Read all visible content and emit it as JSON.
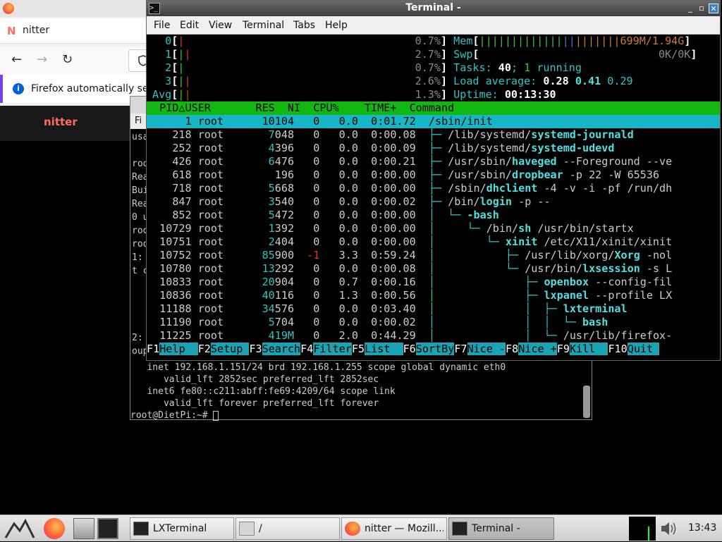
{
  "firefox": {
    "tab_title": "nitter",
    "notice": "Firefox automatically sen",
    "brand": "nitter",
    "tab_icon": "N"
  },
  "lxterminal_bg": {
    "left_column": [
      "usa",
      "",
      "roo",
      "Rea",
      "Bui",
      "Rea",
      "0 u",
      "roo",
      "roo",
      "1:",
      "t c",
      "",
      "",
      "",
      "",
      "2:",
      "oup"
    ],
    "bottom_lines": [
      "   inet 192.168.1.151/24 brd 192.168.1.255 scope global dynamic eth0",
      "      valid_lft 2852sec preferred_lft 2852sec",
      "   inet6 fe80::c211:abff:fe69:4209/64 scope link",
      "      valid_lft forever preferred_lft forever",
      "root@DietPi:~# "
    ]
  },
  "terminal": {
    "title": "Terminal -",
    "menu": [
      "File",
      "Edit",
      "View",
      "Terminal",
      "Tabs",
      "Help"
    ]
  },
  "htop": {
    "cpus": [
      {
        "label": "0",
        "pct": "0.7%"
      },
      {
        "label": "1",
        "pct": "2.7%"
      },
      {
        "label": "2",
        "pct": "0.7%"
      },
      {
        "label": "3",
        "pct": "2.6%"
      },
      {
        "label": "Avg",
        "pct": "1.3%"
      }
    ],
    "mem": {
      "label": "Mem",
      "value": "699M/1.94G"
    },
    "swp": {
      "label": "Swp",
      "value": "0K/0K"
    },
    "tasks": {
      "label": "Tasks:",
      "count": "40",
      "running": "1",
      "suffix": "running"
    },
    "load": {
      "label": "Load average:",
      "a": "0.28",
      "b": "0.41",
      "c": "0.29"
    },
    "uptime": {
      "label": "Uptime:",
      "value": "00:13:30"
    },
    "header": "  PID△USER       RES  NI  CPU%    TIME+  Command",
    "processes": [
      {
        "pid": "1",
        "user": "root",
        "res_hi": "10",
        "res_lo": "104",
        "ni": "0",
        "cpu": "0.0",
        "time": "0:01.72",
        "tree": "",
        "path": "/sbin/",
        "name": "init",
        "args": ""
      },
      {
        "pid": "218",
        "user": "root",
        "res_hi": "7",
        "res_lo": "048",
        "ni": "0",
        "cpu": "0.0",
        "time": "0:00.08",
        "tree": "├─ ",
        "path": "/lib/systemd/",
        "name": "systemd-journald",
        "args": ""
      },
      {
        "pid": "252",
        "user": "root",
        "res_hi": "4",
        "res_lo": "396",
        "ni": "0",
        "cpu": "0.0",
        "time": "0:00.09",
        "tree": "├─ ",
        "path": "/lib/systemd/",
        "name": "systemd-udevd",
        "args": ""
      },
      {
        "pid": "426",
        "user": "root",
        "res_hi": "6",
        "res_lo": "476",
        "ni": "0",
        "cpu": "0.0",
        "time": "0:00.21",
        "tree": "├─ ",
        "path": "/usr/sbin/",
        "name": "haveged",
        "args": " --Foreground --ve"
      },
      {
        "pid": "618",
        "user": "root",
        "res_hi": "",
        "res_lo": "196",
        "ni": "0",
        "cpu": "0.0",
        "time": "0:00.00",
        "tree": "├─ ",
        "path": "/usr/sbin/",
        "name": "dropbear",
        "args": " -p 22 -W 65536"
      },
      {
        "pid": "718",
        "user": "root",
        "res_hi": "5",
        "res_lo": "668",
        "ni": "0",
        "cpu": "0.0",
        "time": "0:00.00",
        "tree": "├─ ",
        "path": "/sbin/",
        "name": "dhclient",
        "args": " -4 -v -i -pf /run/dh"
      },
      {
        "pid": "847",
        "user": "root",
        "res_hi": "3",
        "res_lo": "540",
        "ni": "0",
        "cpu": "0.0",
        "time": "0:00.02",
        "tree": "├─ ",
        "path": "/bin/",
        "name": "login",
        "args": " -p --"
      },
      {
        "pid": "852",
        "user": "root",
        "res_hi": "5",
        "res_lo": "472",
        "ni": "0",
        "cpu": "0.0",
        "time": "0:00.00",
        "tree": "│  └─ ",
        "path": "",
        "name": "-bash",
        "args": ""
      },
      {
        "pid": "10729",
        "user": "root",
        "res_hi": "1",
        "res_lo": "392",
        "ni": "0",
        "cpu": "0.0",
        "time": "0:00.00",
        "tree": "│     └─ ",
        "path": "/bin/",
        "name": "sh",
        "args": " /usr/bin/startx"
      },
      {
        "pid": "10751",
        "user": "root",
        "res_hi": "2",
        "res_lo": "404",
        "ni": "0",
        "cpu": "0.0",
        "time": "0:00.00",
        "tree": "│        └─ ",
        "path": "",
        "name": "xinit",
        "args": " /etc/X11/xinit/xinit"
      },
      {
        "pid": "10752",
        "user": "root",
        "res_hi": "85",
        "res_lo": "900",
        "ni": "-1",
        "cpu": "3.3",
        "time": "0:59.24",
        "tree": "│           ├─ ",
        "path": "/usr/lib/xorg/",
        "name": "Xorg",
        "args": " -nol"
      },
      {
        "pid": "10780",
        "user": "root",
        "res_hi": "13",
        "res_lo": "292",
        "ni": "0",
        "cpu": "0.0",
        "time": "0:00.08",
        "tree": "│           └─ ",
        "path": "/usr/bin/",
        "name": "lxsession",
        "args": " -s L"
      },
      {
        "pid": "10833",
        "user": "root",
        "res_hi": "20",
        "res_lo": "904",
        "ni": "0",
        "cpu": "0.7",
        "time": "0:00.16",
        "tree": "│              ├─ ",
        "path": "",
        "name": "openbox",
        "args": " --config-fil"
      },
      {
        "pid": "10836",
        "user": "root",
        "res_hi": "40",
        "res_lo": "116",
        "ni": "0",
        "cpu": "1.3",
        "time": "0:00.56",
        "tree": "│              ├─ ",
        "path": "",
        "name": "lxpanel",
        "args": " --profile LX"
      },
      {
        "pid": "11188",
        "user": "root",
        "res_hi": "34",
        "res_lo": "576",
        "ni": "0",
        "cpu": "0.0",
        "time": "0:03.40",
        "tree": "│              │  ├─ ",
        "path": "",
        "name": "lxterminal",
        "args": ""
      },
      {
        "pid": "11190",
        "user": "root",
        "res_hi": "5",
        "res_lo": "704",
        "ni": "0",
        "cpu": "0.0",
        "time": "0:00.02",
        "tree": "│              │  │  └─ ",
        "path": "",
        "name": "bash",
        "args": ""
      },
      {
        "pid": "11225",
        "user": "root",
        "res_hi": "419M",
        "res_lo": "",
        "ni": "0",
        "cpu": "2.0",
        "time": "0:44.29",
        "tree": "│              │  └─ ",
        "path": "/usr/lib/firefox-",
        "name": "",
        "args": ""
      }
    ],
    "fkeys": [
      {
        "key": "F1",
        "label": "Help  "
      },
      {
        "key": "F2",
        "label": "Setup "
      },
      {
        "key": "F3",
        "label": "Search"
      },
      {
        "key": "F4",
        "label": "Filter"
      },
      {
        "key": "F5",
        "label": "List  "
      },
      {
        "key": "F6",
        "label": "SortBy"
      },
      {
        "key": "F7",
        "label": "Nice -"
      },
      {
        "key": "F8",
        "label": "Nice +"
      },
      {
        "key": "F9",
        "label": "Kill  "
      },
      {
        "key": "F10",
        "label": "Quit "
      }
    ]
  },
  "taskbar": {
    "buttons": [
      {
        "label": "LXTerminal",
        "icon": "terminal-icon"
      },
      {
        "label": "/",
        "icon": "folder-icon"
      },
      {
        "label": "nitter — Mozill...",
        "icon": "firefox-icon"
      },
      {
        "label": "Terminal -",
        "icon": "terminal-icon"
      }
    ],
    "clock": "13:43"
  },
  "colors": {
    "header_bg": "#12b712",
    "selected_bg": "#16b6c6",
    "fkey_bg": "#1ba3b3"
  }
}
